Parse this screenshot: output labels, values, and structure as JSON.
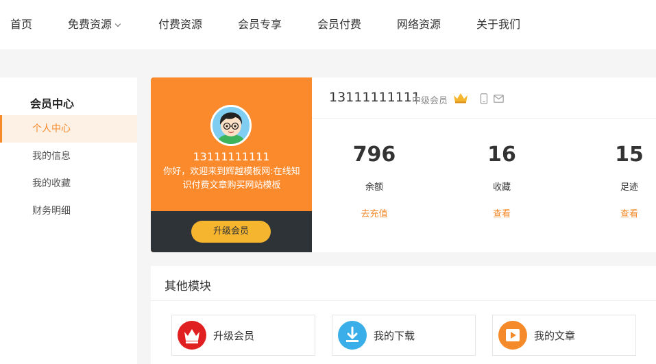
{
  "nav": {
    "home": "首页",
    "free": "免费资源",
    "paid": "付费资源",
    "member": "会员专享",
    "member_pay": "会员付费",
    "network": "网络资源",
    "about": "关于我们"
  },
  "sidebar": {
    "title": "会员中心",
    "items": [
      {
        "label": "个人中心",
        "active": true
      },
      {
        "label": "我的信息"
      },
      {
        "label": "我的收藏"
      },
      {
        "label": "财务明细"
      }
    ]
  },
  "profile": {
    "username": "13111111111",
    "welcome": "你好，欢迎来到辉越模板网:在线知识付费文章购买网站模板",
    "upgrade_label": "升级会员"
  },
  "account": {
    "phone": "13111111111",
    "level": "中级会员",
    "stats": [
      {
        "value": "796",
        "label": "余额",
        "action": "去充值"
      },
      {
        "value": "16",
        "label": "收藏",
        "action": "查看"
      },
      {
        "value": "15",
        "label": "足迹",
        "action": "查看"
      }
    ]
  },
  "modules": {
    "title": "其他模块",
    "items": [
      {
        "label": "升级会员",
        "icon": "crown-icon",
        "color": "#e02020"
      },
      {
        "label": "我的下载",
        "icon": "download-icon",
        "color": "#3aaee8"
      },
      {
        "label": "我的文章",
        "icon": "play-icon",
        "color": "#f58a2a"
      }
    ]
  },
  "colors": {
    "accent": "#f58a2a",
    "card_orange": "#fb8a2c",
    "card_dark": "#2e3338",
    "upgrade_yellow": "#f5b52f"
  }
}
